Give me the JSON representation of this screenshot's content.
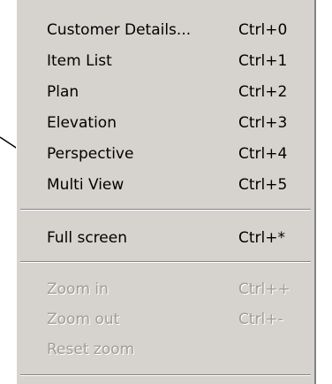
{
  "menu": {
    "items": [
      {
        "label": "Customer Details...",
        "shortcut": "Ctrl+0",
        "enabled": true
      },
      {
        "label": "Item List",
        "shortcut": "Ctrl+1",
        "enabled": true
      },
      {
        "label": "Plan",
        "shortcut": "Ctrl+2",
        "enabled": true
      },
      {
        "label": "Elevation",
        "shortcut": "Ctrl+3",
        "enabled": true
      },
      {
        "label": "Perspective",
        "shortcut": "Ctrl+4",
        "enabled": true
      },
      {
        "label": "Multi View",
        "shortcut": "Ctrl+5",
        "enabled": true
      },
      {
        "label": "Full screen",
        "shortcut": "Ctrl+*",
        "enabled": true
      },
      {
        "label": "Zoom in",
        "shortcut": "Ctrl++",
        "enabled": false
      },
      {
        "label": "Zoom out",
        "shortcut": "Ctrl+-",
        "enabled": false
      },
      {
        "label": "Reset zoom",
        "shortcut": "",
        "enabled": false
      }
    ]
  },
  "colors": {
    "menu_background": "#d6d3ce",
    "disabled_text": "#a09d98",
    "separator_dark": "#848284",
    "separator_light": "#ffffff",
    "arrow": "#000000"
  },
  "annotation": {
    "arrow_icon": "annotation-arrow-icon"
  }
}
